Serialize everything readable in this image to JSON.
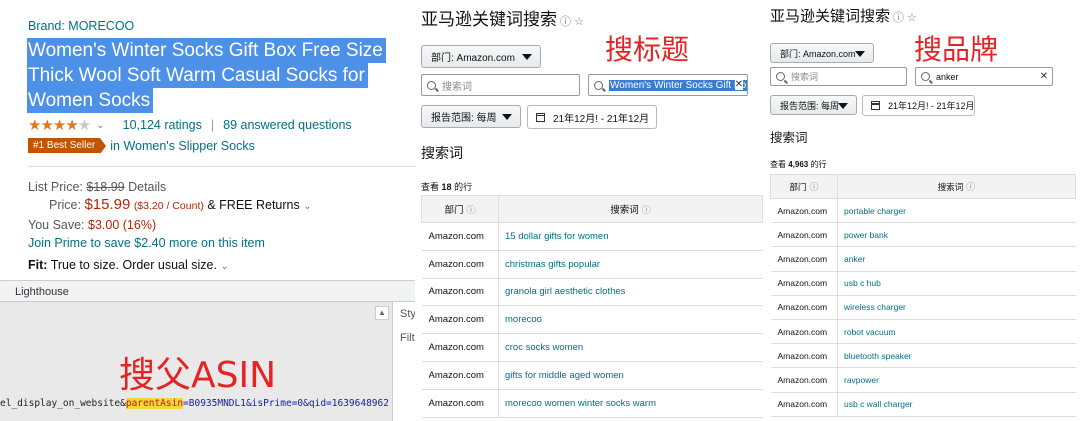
{
  "product": {
    "brand": "Brand: MORECOO",
    "title_lines": [
      "Women's Winter Socks Gift Box Free Size",
      "Thick Wool Soft Warm Casual Socks for",
      "Women Socks"
    ],
    "rating_stars": 4.5,
    "stars_glyph": "★★★★★",
    "ratings": "10,124 ratings",
    "answered": "89 answered questions",
    "best_seller_badge": "#1 Best Seller",
    "best_seller_category": "in Women's Slipper Socks",
    "list_price_label": "List Price:",
    "list_price": "$18.99",
    "details": "Details",
    "price_label": "Price:",
    "price": "$15.99",
    "price_per": "($3.20 / Count)",
    "free_returns": "& FREE Returns",
    "you_save_label": "You Save:",
    "you_save": "$3.00 (16%)",
    "prime_text": "Join Prime to save $2.40 more on this item",
    "fit_label": "Fit:",
    "fit_text": "True to size. Order usual size."
  },
  "devtools": {
    "tab": "Lighthouse",
    "side_tab": "Sty",
    "side_filter": "Filte",
    "url_prefix": "el_display_on_website&",
    "url_highlight": "parentAsin",
    "url_rest": "=B0935MNDL1&isPrime=0&qid=1639648962",
    "annotation": "搜父ASIN"
  },
  "mid": {
    "title": "亚马逊关键词搜索",
    "dept_select": "部门: Amazon.com",
    "search_placeholder": "搜索词",
    "search_value": "Women's Winter Socks Gift Bo",
    "range_select": "报告范围: 每周",
    "date_range": "21年12月! - 21年12月",
    "section_label": "搜索词",
    "count_prefix": "查看",
    "count": "18",
    "count_suffix": "的行",
    "col_dept": "部门",
    "col_term": "搜索词",
    "annotation": "搜标题",
    "rows": [
      {
        "dept": "Amazon.com",
        "term": "15 dollar gifts for women"
      },
      {
        "dept": "Amazon.com",
        "term": "christmas gifts popular"
      },
      {
        "dept": "Amazon.com",
        "term": "granola girl aesthetic clothes"
      },
      {
        "dept": "Amazon.com",
        "term": "morecoo"
      },
      {
        "dept": "Amazon.com",
        "term": "croc socks women"
      },
      {
        "dept": "Amazon.com",
        "term": "gifts for middle aged women"
      },
      {
        "dept": "Amazon.com",
        "term": "morecoo women winter socks warm"
      }
    ]
  },
  "right": {
    "title": "亚马逊关键词搜索",
    "dept_select": "部门: Amazon.com",
    "search_placeholder": "搜索词",
    "search_value": "anker",
    "range_select": "报告范围: 每周",
    "date_range": "21年12月! - 21年12月",
    "section_label": "搜索词",
    "count_prefix": "查看",
    "count": "4,963",
    "count_suffix": "的行",
    "col_dept": "部门",
    "col_term": "搜索词",
    "annotation": "搜品牌",
    "rows": [
      {
        "dept": "Amazon.com",
        "term": "portable charger"
      },
      {
        "dept": "Amazon.com",
        "term": "power bank"
      },
      {
        "dept": "Amazon.com",
        "term": "anker"
      },
      {
        "dept": "Amazon.com",
        "term": "usb c hub"
      },
      {
        "dept": "Amazon.com",
        "term": "wireless charger"
      },
      {
        "dept": "Amazon.com",
        "term": "robot vacuum"
      },
      {
        "dept": "Amazon.com",
        "term": "bluetooth speaker"
      },
      {
        "dept": "Amazon.com",
        "term": "ravpower"
      },
      {
        "dept": "Amazon.com",
        "term": "usb c wall charger"
      }
    ]
  },
  "colors": {
    "highlight": "#4c90e8",
    "annotation": "#e42424",
    "link": "#007185",
    "price": "#b12704"
  }
}
